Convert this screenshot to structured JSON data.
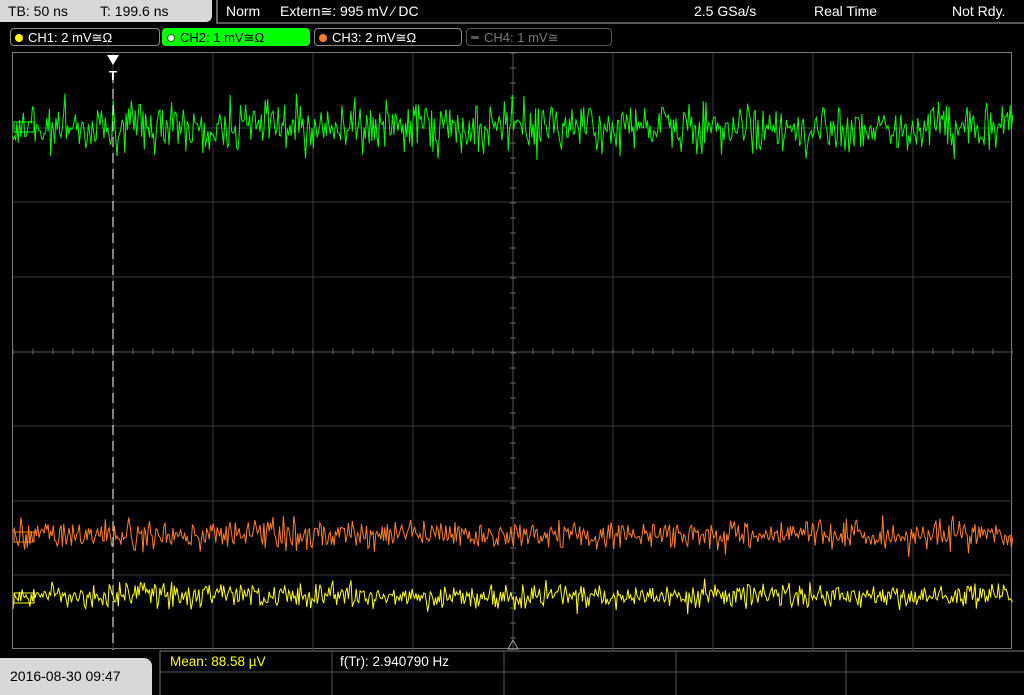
{
  "topbar": {
    "timebase": "TB: 50 ns",
    "trigger_time": "T: 199.6 ns",
    "mode": "Norm",
    "trigger_source": "Extern≅: 995 mV ⁄ DC",
    "sample_rate": "2.5 GSa/s",
    "acq_mode": "Real Time",
    "status": "Not Rdy."
  },
  "channels": [
    {
      "label": "CH1: 2 mV≅Ω",
      "color": "#ffff00"
    },
    {
      "label": "CH2: 1 mV≅Ω",
      "color": "#00ff00"
    },
    {
      "label": "CH3: 2 mV≅Ω",
      "color": "#ff7f27"
    },
    {
      "label": "CH4: 1 mV≅",
      "color": "#777777"
    }
  ],
  "trigger_marker": "T",
  "footer": {
    "datetime": "2016-08-30 09:47",
    "mean": "Mean: 88.58 µV",
    "freq": "f(Tr): 2.940790 Hz"
  }
}
